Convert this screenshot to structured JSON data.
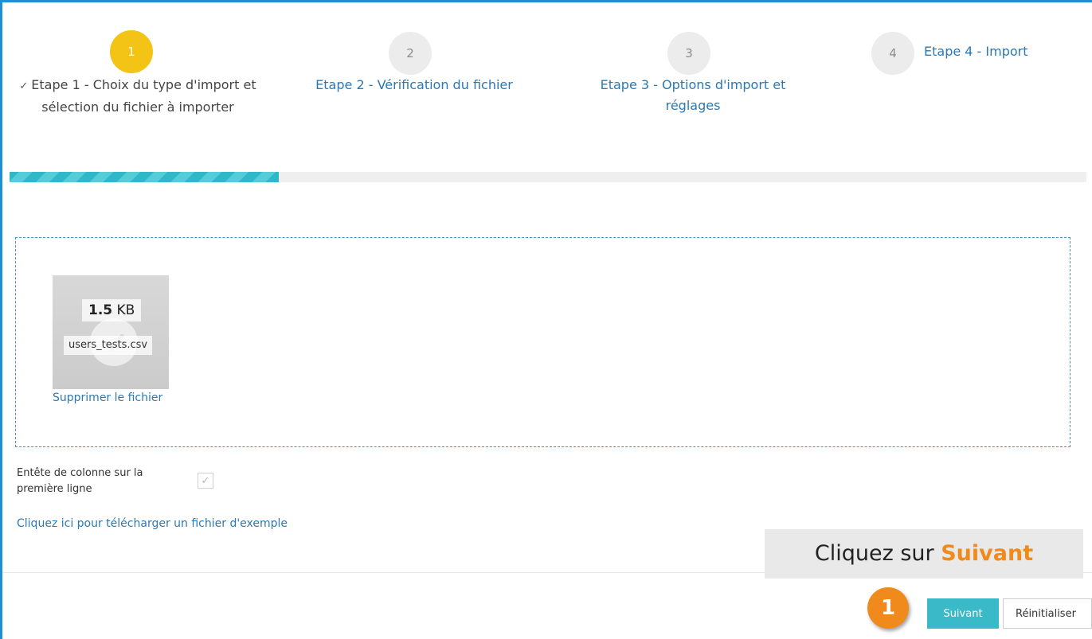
{
  "stepper": {
    "steps": [
      {
        "number": "1",
        "label": "Etape 1 - Choix du type d'import et sélection du fichier à importer",
        "check_icon": "checkmark-icon",
        "state": "current"
      },
      {
        "number": "2",
        "label": "Etape 2 - Vérification du fichier",
        "state": "pending"
      },
      {
        "number": "3",
        "label": "Etape 3 - Options d'import et réglages",
        "state": "pending"
      },
      {
        "number": "4",
        "label": "Etape 4 - Import",
        "state": "pending"
      }
    ],
    "progress_fraction": 0.25,
    "colors": {
      "active_circle": "#f3c316",
      "progress": "#2eb8c8",
      "link": "#2a79b5"
    }
  },
  "upload": {
    "file_size_value": "1.5",
    "file_size_unit": "KB",
    "file_name": "users_tests.csv",
    "remove_link": "Supprimer le fichier"
  },
  "options": {
    "header_label": "Entête de colonne sur la première ligne",
    "header_checked": true
  },
  "example_link": "Cliquez ici pour télécharger un fichier d'exemple",
  "annotation": {
    "text_prefix": "Cliquez sur ",
    "text_highlight": "Suivant",
    "badge_number": "1",
    "highlight_color": "#f08a1c"
  },
  "buttons": {
    "next_label": "Suivant",
    "reset_label": "Réinitialiser"
  }
}
